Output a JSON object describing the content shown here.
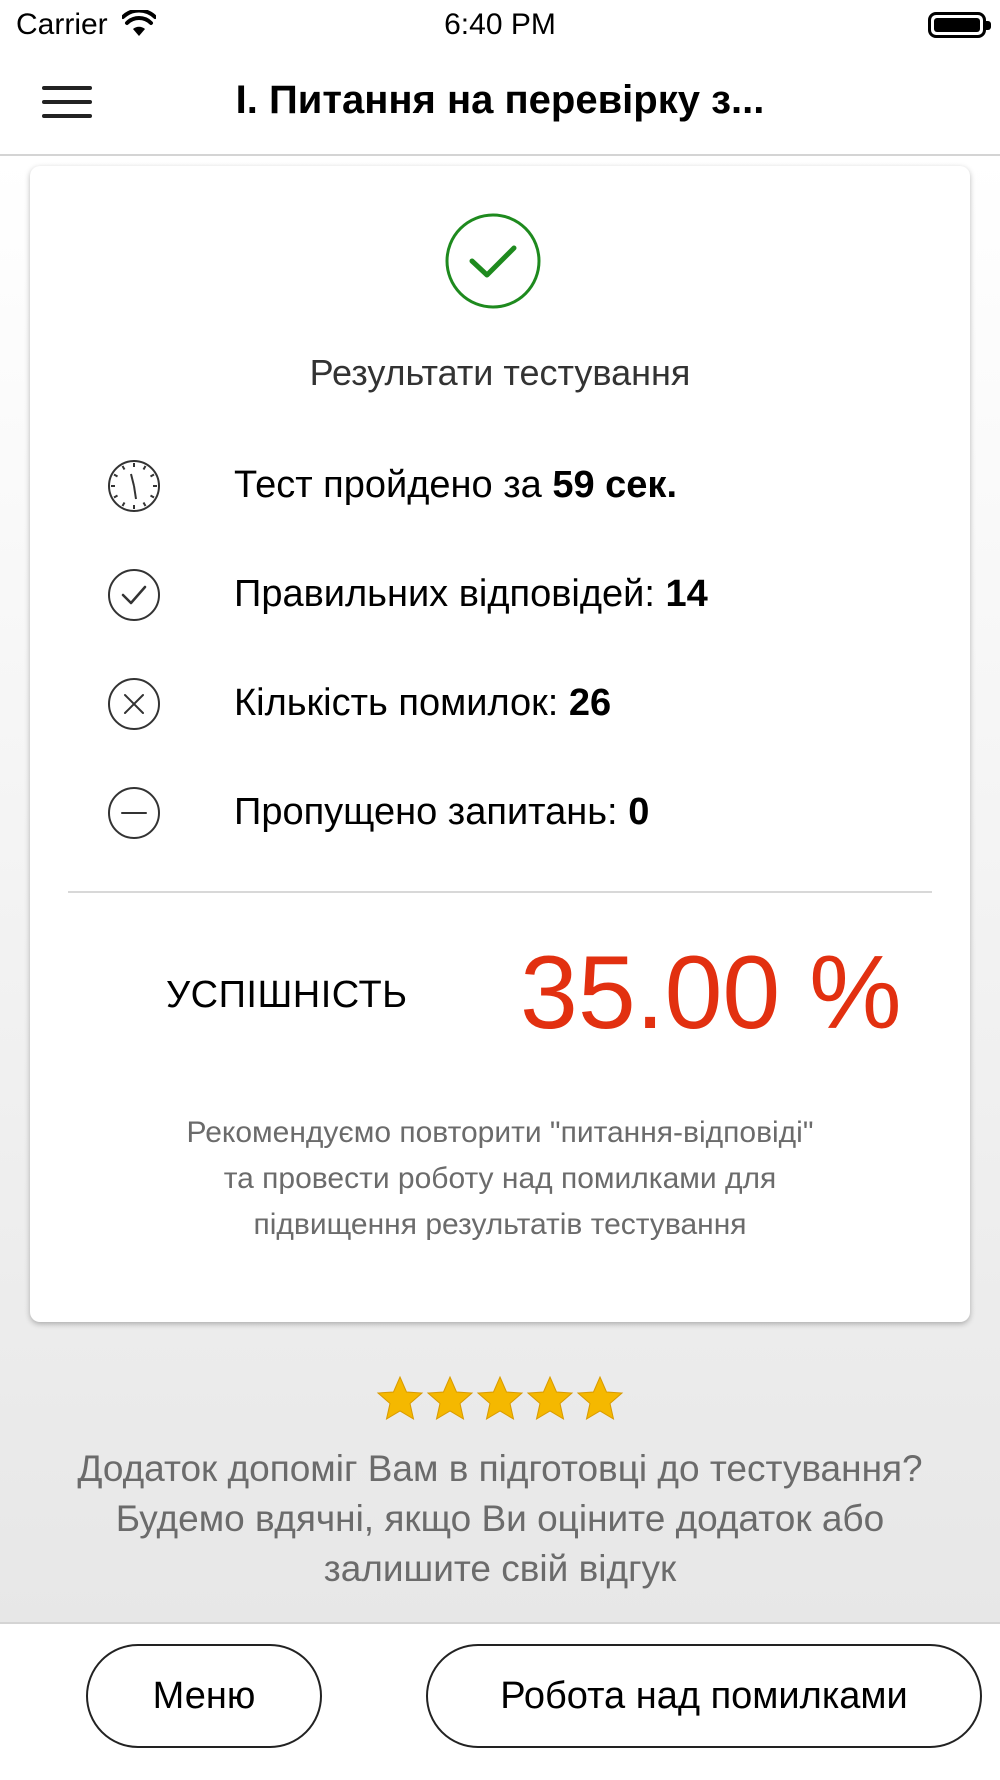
{
  "status_bar": {
    "carrier": "Carrier",
    "time": "6:40 PM"
  },
  "nav": {
    "title": "І. Питання на перевірку з..."
  },
  "card": {
    "title": "Результати тестування",
    "stats": [
      {
        "icon": "clock-icon",
        "label": "Тест пройдено за ",
        "value": "59 сек."
      },
      {
        "icon": "check-circle-icon",
        "label": "Правильних відповідей: ",
        "value": "14"
      },
      {
        "icon": "x-circle-icon",
        "label": "Кількість помилок: ",
        "value": "26"
      },
      {
        "icon": "minus-circle-icon",
        "label": "Пропущено запитань: ",
        "value": "0"
      }
    ],
    "success_label": "УСПІШНІСТЬ",
    "success_value": "35.00 %",
    "advice": [
      "Рекомендуємо повторити \"питання-відповіді\"",
      "та провести роботу над помилками для",
      "підвищення результатів тестування"
    ]
  },
  "rating": {
    "stars": 5,
    "text": [
      "Додаток допоміг Вам в підготовці до тестування?",
      "Будемо вдячні, якщо Ви оціните додаток або",
      "залишите свій відгук"
    ]
  },
  "buttons": {
    "menu": "Меню",
    "mistakes": "Робота над помилками"
  },
  "colors": {
    "accent_red": "#e23010",
    "success_green": "#1e8a1e",
    "star_gold": "#f5b800"
  }
}
